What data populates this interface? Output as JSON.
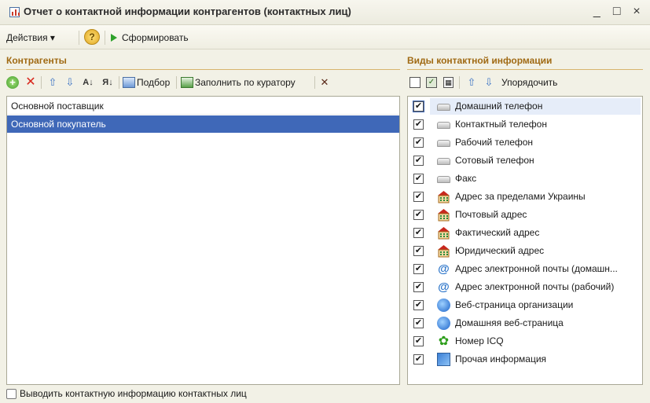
{
  "window": {
    "title": "Отчет о контактной информации контрагентов (контактных лиц)",
    "controls": [
      "_",
      "□",
      "×"
    ]
  },
  "menubar": {
    "actions_label": "Действия ▾",
    "help_label": "?",
    "generate_label": "Сформировать"
  },
  "left": {
    "header": "Контрагенты",
    "toolbar": {
      "select_label": "Подбор",
      "fill_label": "Заполнить по куратору"
    },
    "items": [
      {
        "label": "Основной поставщик",
        "selected": false
      },
      {
        "label": "Основной покупатель",
        "selected": true
      }
    ]
  },
  "right": {
    "header": "Виды контактной информации",
    "toolbar": {
      "order_label": "Упорядочить"
    },
    "items": [
      {
        "label": "Домашний телефон",
        "icon": "phone-icon",
        "checked": true
      },
      {
        "label": "Контактный телефон",
        "icon": "phone-icon",
        "checked": true
      },
      {
        "label": "Рабочий телефон",
        "icon": "phone-icon",
        "checked": true
      },
      {
        "label": "Сотовый телефон",
        "icon": "phone-icon",
        "checked": true
      },
      {
        "label": "Факс",
        "icon": "phone-icon",
        "checked": true
      },
      {
        "label": "Адрес за пределами Украины",
        "icon": "house-icon",
        "checked": true
      },
      {
        "label": "Почтовый адрес",
        "icon": "house-icon",
        "checked": true
      },
      {
        "label": "Фактический адрес",
        "icon": "house-icon",
        "checked": true
      },
      {
        "label": "Юридический адрес",
        "icon": "house-icon",
        "checked": true
      },
      {
        "label": "Адрес электронной почты (домашн...",
        "icon": "at-icon",
        "checked": true
      },
      {
        "label": "Адрес электронной почты (рабочий)",
        "icon": "at-icon",
        "checked": true
      },
      {
        "label": "Веб-страница организации",
        "icon": "web-icon",
        "checked": true
      },
      {
        "label": "Домашняя веб-страница",
        "icon": "web-icon",
        "checked": true
      },
      {
        "label": "Номер ICQ",
        "icon": "icq-icon",
        "checked": true
      },
      {
        "label": "Прочая информация",
        "icon": "info-icon",
        "checked": true
      }
    ]
  },
  "footer": {
    "checkbox_label": "Выводить контактную информацию контактных лиц",
    "checked": false
  },
  "colors": {
    "accent": "#3f68b8",
    "section_header": "#a06a14"
  }
}
